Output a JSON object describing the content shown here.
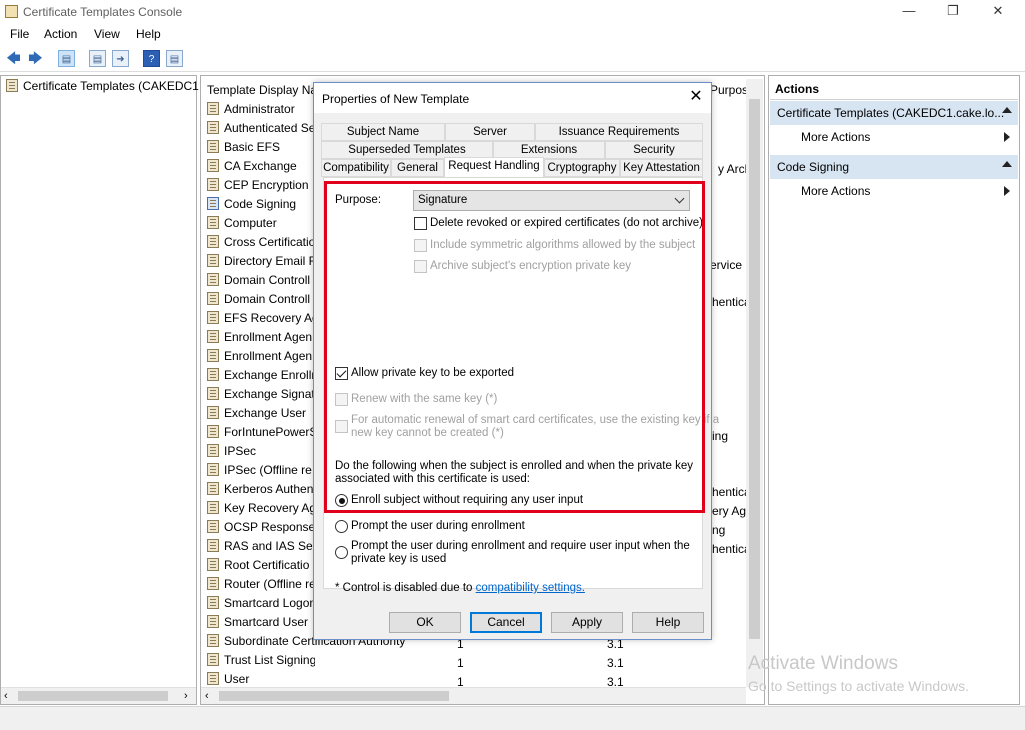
{
  "window": {
    "title": "Certificate Templates Console"
  },
  "menu": [
    "File",
    "Action",
    "View",
    "Help"
  ],
  "tree": {
    "root_label": "Certificate Templates (CAKEDC1"
  },
  "list": {
    "header_name": "Template Display Na",
    "header_purpose_partial": "Purpos",
    "items": [
      {
        "name": "Administrator"
      },
      {
        "name": "Authenticated Se"
      },
      {
        "name": "Basic EFS"
      },
      {
        "name": "CA Exchange"
      },
      {
        "name": "CEP Encryption"
      },
      {
        "name": "Code Signing"
      },
      {
        "name": "Computer"
      },
      {
        "name": "Cross Certificatio"
      },
      {
        "name": "Directory Email R"
      },
      {
        "name": "Domain Controll"
      },
      {
        "name": "Domain Controll"
      },
      {
        "name": "EFS Recovery Ag"
      },
      {
        "name": "Enrollment Agen"
      },
      {
        "name": "Enrollment Agen"
      },
      {
        "name": "Exchange Enrollm"
      },
      {
        "name": "Exchange Signatu"
      },
      {
        "name": "Exchange User"
      },
      {
        "name": "ForIntunePowerS"
      },
      {
        "name": "IPSec"
      },
      {
        "name": "IPSec (Offline re"
      },
      {
        "name": "Kerberos Authen"
      },
      {
        "name": "Key Recovery Ag"
      },
      {
        "name": "OCSP Response S"
      },
      {
        "name": "RAS and IAS Serv"
      },
      {
        "name": "Root Certificatio"
      },
      {
        "name": "Router (Offline re"
      },
      {
        "name": "Smartcard Logon"
      },
      {
        "name": "Smartcard User"
      },
      {
        "name": "Subordinate Certification Authority"
      },
      {
        "name": "Trust List Signing"
      },
      {
        "name": "User"
      }
    ],
    "right_fragments": [
      {
        "text": "y Archi"
      },
      {
        "text": "ervice"
      },
      {
        "text": "henticati"
      },
      {
        "text": "ing"
      },
      {
        "text": "henticati"
      },
      {
        "text": "ery Ag"
      },
      {
        "text": "ng"
      },
      {
        "text": "henticati"
      }
    ],
    "tail_rows": [
      {
        "schema": "1",
        "version": "3.1"
      },
      {
        "schema": "1",
        "version": "3.1"
      },
      {
        "schema": "1",
        "version": "3.1"
      }
    ]
  },
  "actions": {
    "header": "Actions",
    "sections": [
      {
        "title": "Certificate Templates (CAKEDC1.cake.lo...",
        "link": "More Actions"
      },
      {
        "title": "Code Signing",
        "link": "More Actions"
      }
    ]
  },
  "watermark": {
    "line1": "Activate Windows",
    "line2": "Go to Settings to activate Windows."
  },
  "dialog": {
    "title": "Properties of New Template",
    "tabs_row1": [
      "Subject Name",
      "Server",
      "Issuance Requirements"
    ],
    "tabs_row2": [
      "Superseded Templates",
      "Extensions",
      "Security"
    ],
    "tabs_row3": [
      "Compatibility",
      "General",
      "Request Handling",
      "Cryptography",
      "Key Attestation"
    ],
    "active_tab": "Request Handling",
    "purpose_label": "Purpose:",
    "purpose_value": "Signature",
    "cb_delete_revoked": "Delete revoked or expired certificates (do not archive)",
    "cb_symmetric": "Include symmetric algorithms allowed by the subject",
    "cb_archive": "Archive subject's encryption private key",
    "cb_allow_export": "Allow private key to be exported",
    "cb_renew_same_key": "Renew with the same key (*)",
    "cb_smartcard_line1": "For automatic renewal of smart card certificates, use the existing key if a",
    "cb_smartcard_line2": "new key cannot be created (*)",
    "enroll_text_line1": "Do the following when the subject is enrolled and when the private key",
    "enroll_text_line2": "associated with this certificate is used:",
    "radio_enroll_without": "Enroll subject without requiring any user input",
    "radio_prompt": "Prompt the user during enrollment",
    "radio_prompt_require_line1": "Prompt the user during enrollment and require user input when the",
    "radio_prompt_require_line2": "private key is used",
    "footnote_prefix": "* Control is disabled due to ",
    "footnote_link": "compatibility settings.",
    "buttons": {
      "ok": "OK",
      "cancel": "Cancel",
      "apply": "Apply",
      "help": "Help"
    },
    "highlight_color": "#e0001b"
  }
}
